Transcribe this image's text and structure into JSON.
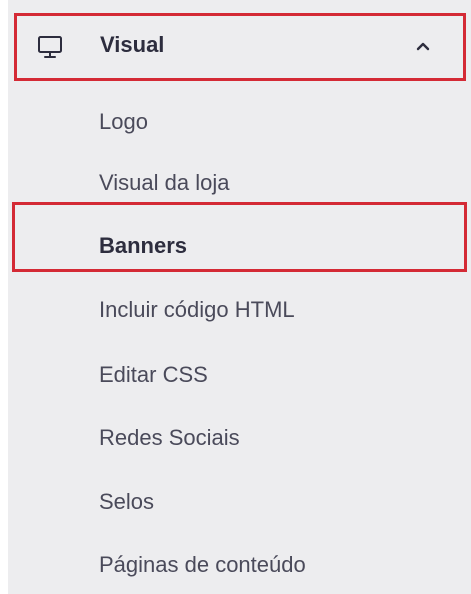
{
  "menu": {
    "section": {
      "label": "Visual",
      "icon": "monitor-icon",
      "toggle_icon": "chevron-up-icon",
      "expanded": true
    },
    "items": [
      {
        "label": "Logo",
        "active": false
      },
      {
        "label": "Visual da loja",
        "active": false
      },
      {
        "label": "Banners",
        "active": true
      },
      {
        "label": "Incluir código HTML",
        "active": false
      },
      {
        "label": "Editar CSS",
        "active": false
      },
      {
        "label": "Redes Sociais",
        "active": false
      },
      {
        "label": "Selos",
        "active": false
      },
      {
        "label": "Páginas de conteúdo",
        "active": false
      }
    ]
  },
  "colors": {
    "panel_background": "#ededef",
    "highlight_border": "#d42a35",
    "heading_text": "#2d2d3e",
    "item_text": "#4a4a5a"
  }
}
